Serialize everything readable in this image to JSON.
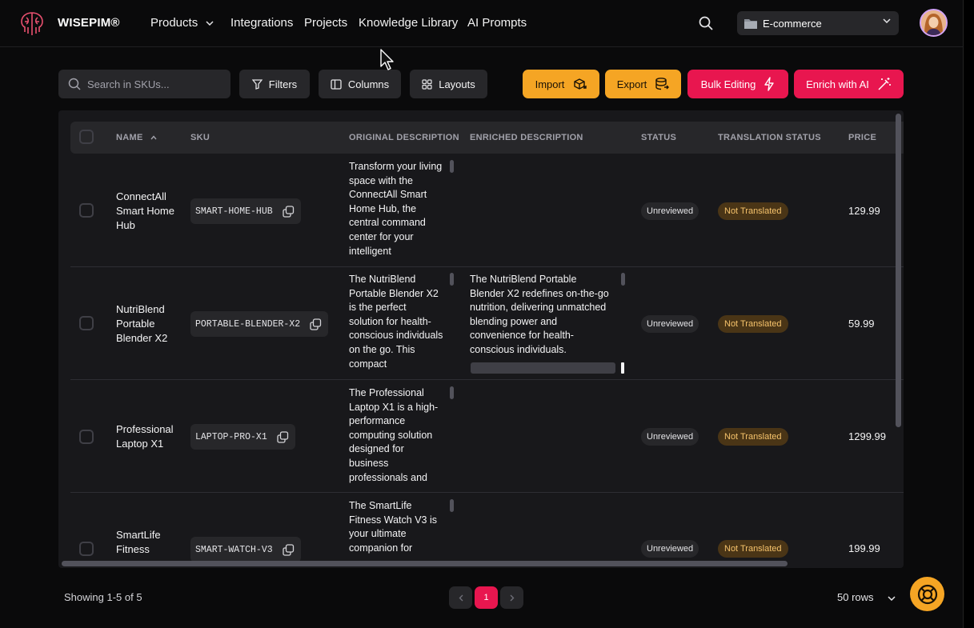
{
  "app": {
    "brand": "WISEPIM®"
  },
  "nav": {
    "items": [
      "Products",
      "Integrations",
      "Projects",
      "Knowledge Library",
      "AI Prompts"
    ]
  },
  "workspace": {
    "selected": "E-commerce"
  },
  "toolbar": {
    "search_placeholder": "Search in SKUs...",
    "filters": "Filters",
    "columns": "Columns",
    "layouts": "Layouts",
    "import": "Import",
    "export": "Export",
    "bulk_editing": "Bulk Editing",
    "enrich": "Enrich with AI"
  },
  "table": {
    "headers": [
      "NAME",
      "SKU",
      "ORIGINAL DESCRIPTION",
      "ENRICHED DESCRIPTION",
      "STATUS",
      "TRANSLATION STATUS",
      "PRICE"
    ],
    "rows": [
      {
        "name": "ConnectAll Smart Home Hub",
        "sku": "SMART-HOME-HUB",
        "original": "Transform your living space with the ConnectAll Smart Home Hub, the central command center for your intelligent",
        "enriched": "",
        "status": "Unreviewed",
        "translation": "Not Translated",
        "price": "129.99"
      },
      {
        "name": "NutriBlend Portable Blender X2",
        "sku": "PORTABLE-BLENDER-X2",
        "original": "The NutriBlend Portable Blender X2 is the perfect solution for health-conscious individuals on the go. This compact",
        "enriched": "The NutriBlend Portable Blender X2 redefines on-the-go nutrition, delivering unmatched blending power and convenience for health-conscious individuals.",
        "status": "Unreviewed",
        "translation": "Not Translated",
        "price": "59.99"
      },
      {
        "name": "Professional Laptop X1",
        "sku": "LAPTOP-PRO-X1",
        "original": "The Professional Laptop X1 is a high-performance computing solution designed for business professionals and",
        "enriched": "",
        "status": "Unreviewed",
        "translation": "Not Translated",
        "price": "1299.99"
      },
      {
        "name": "SmartLife Fitness",
        "sku": "SMART-WATCH-V3",
        "original": "The SmartLife Fitness Watch V3 is your ultimate companion for",
        "enriched": "",
        "status": "Unreviewed",
        "translation": "Not Translated",
        "price": "199.99"
      }
    ]
  },
  "footer": {
    "showing": "Showing 1-5 of 5",
    "page": "1",
    "rows_per_page": "50 rows"
  },
  "icons": {
    "search": "search-icon",
    "filter": "filter-icon",
    "columns": "columns-icon",
    "layouts": "grid-icon",
    "import": "box-import-icon",
    "export": "database-export-icon",
    "bulk": "lightning-icon",
    "enrich": "magic-wand-icon",
    "copy": "copy-icon",
    "help": "lifebuoy-icon"
  },
  "colors": {
    "accent_red": "#e8164f",
    "accent_orange": "#f5a524",
    "translation_badge_bg": "#4a3516",
    "translation_badge_text": "#f5c26b"
  }
}
